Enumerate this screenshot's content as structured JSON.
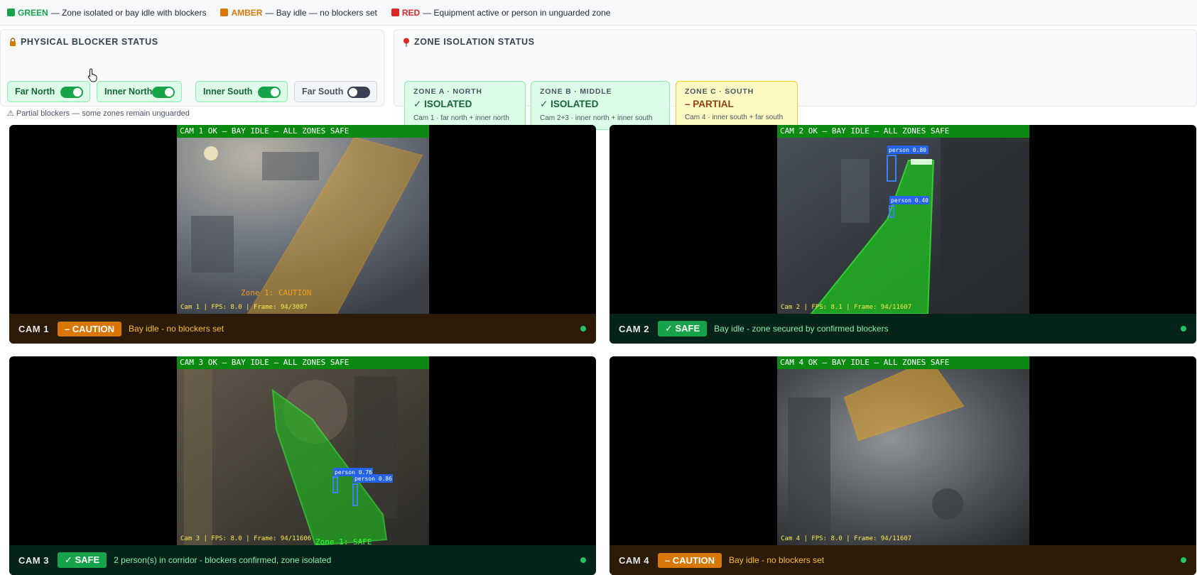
{
  "legend": [
    {
      "key": "GREEN",
      "text": " — Zone isolated or bay idle with blockers",
      "color": "#16a34a"
    },
    {
      "key": "AMBER",
      "text": " — Bay idle — no blockers set",
      "color": "#d97706"
    },
    {
      "key": "RED",
      "text": " — Equipment active or person in unguarded zone",
      "color": "#dc2626"
    }
  ],
  "blockers": {
    "title": "PHYSICAL BLOCKER STATUS",
    "icon": "lock-icon",
    "toggles": [
      {
        "label": "Far North",
        "on": true
      },
      {
        "label": "Inner North",
        "on": true
      },
      {
        "label": "Inner South",
        "on": true
      },
      {
        "label": "Far South",
        "on": false
      }
    ],
    "warning": "⚠ Partial blockers — some zones remain unguarded"
  },
  "zones": {
    "title": "ZONE ISOLATION STATUS",
    "icon": "pin-icon",
    "cards": [
      {
        "name": "ZONE A · NORTH",
        "status": "✓ ISOLATED",
        "desc": "Cam 1 · far north + inner north"
      },
      {
        "name": "ZONE B · MIDDLE",
        "status": "✓ ISOLATED",
        "desc": "Cam 2+3 · inner north + inner south"
      },
      {
        "name": "ZONE C · SOUTH",
        "status": "– PARTIAL",
        "desc": "Cam 4 · inner south + far south"
      }
    ]
  },
  "cameras": [
    {
      "label": "CAM 1",
      "banner": "CAM 1  OK — BAY IDLE — ALL ZONES SAFE",
      "meta": "Cam 1 | FPS: 8.0 | Frame: 94/3087",
      "badge": "– CAUTION",
      "message": "Bay idle - no blockers set",
      "zone_text": "Zone 1: CAUTION"
    },
    {
      "label": "CAM 2",
      "banner": "CAM 2  OK — BAY IDLE — ALL ZONES SAFE",
      "meta": "Cam 2 | FPS: 8.1 | Frame: 94/11607",
      "badge": "✓ SAFE",
      "message": "Bay idle - zone secured by confirmed blockers",
      "detections": [
        "person 0.80",
        "person 0.40"
      ]
    },
    {
      "label": "CAM 3",
      "banner": "CAM 3  OK — BAY IDLE — ALL ZONES SAFE",
      "meta": "Cam 3 | FPS: 8.0 | Frame: 94/11606",
      "badge": "✓ SAFE",
      "message": "2 person(s) in corridor - blockers confirmed, zone isolated",
      "zone_text": "Zone 1: SAFE",
      "detections": [
        "person 0.76",
        "person 0.86"
      ]
    },
    {
      "label": "CAM 4",
      "banner": "CAM 4  OK — BAY IDLE — ALL ZONES SAFE",
      "meta": "Cam 4 | FPS: 8.0 | Frame: 94/11607",
      "badge": "– CAUTION",
      "message": "Bay idle - no blockers set"
    }
  ]
}
